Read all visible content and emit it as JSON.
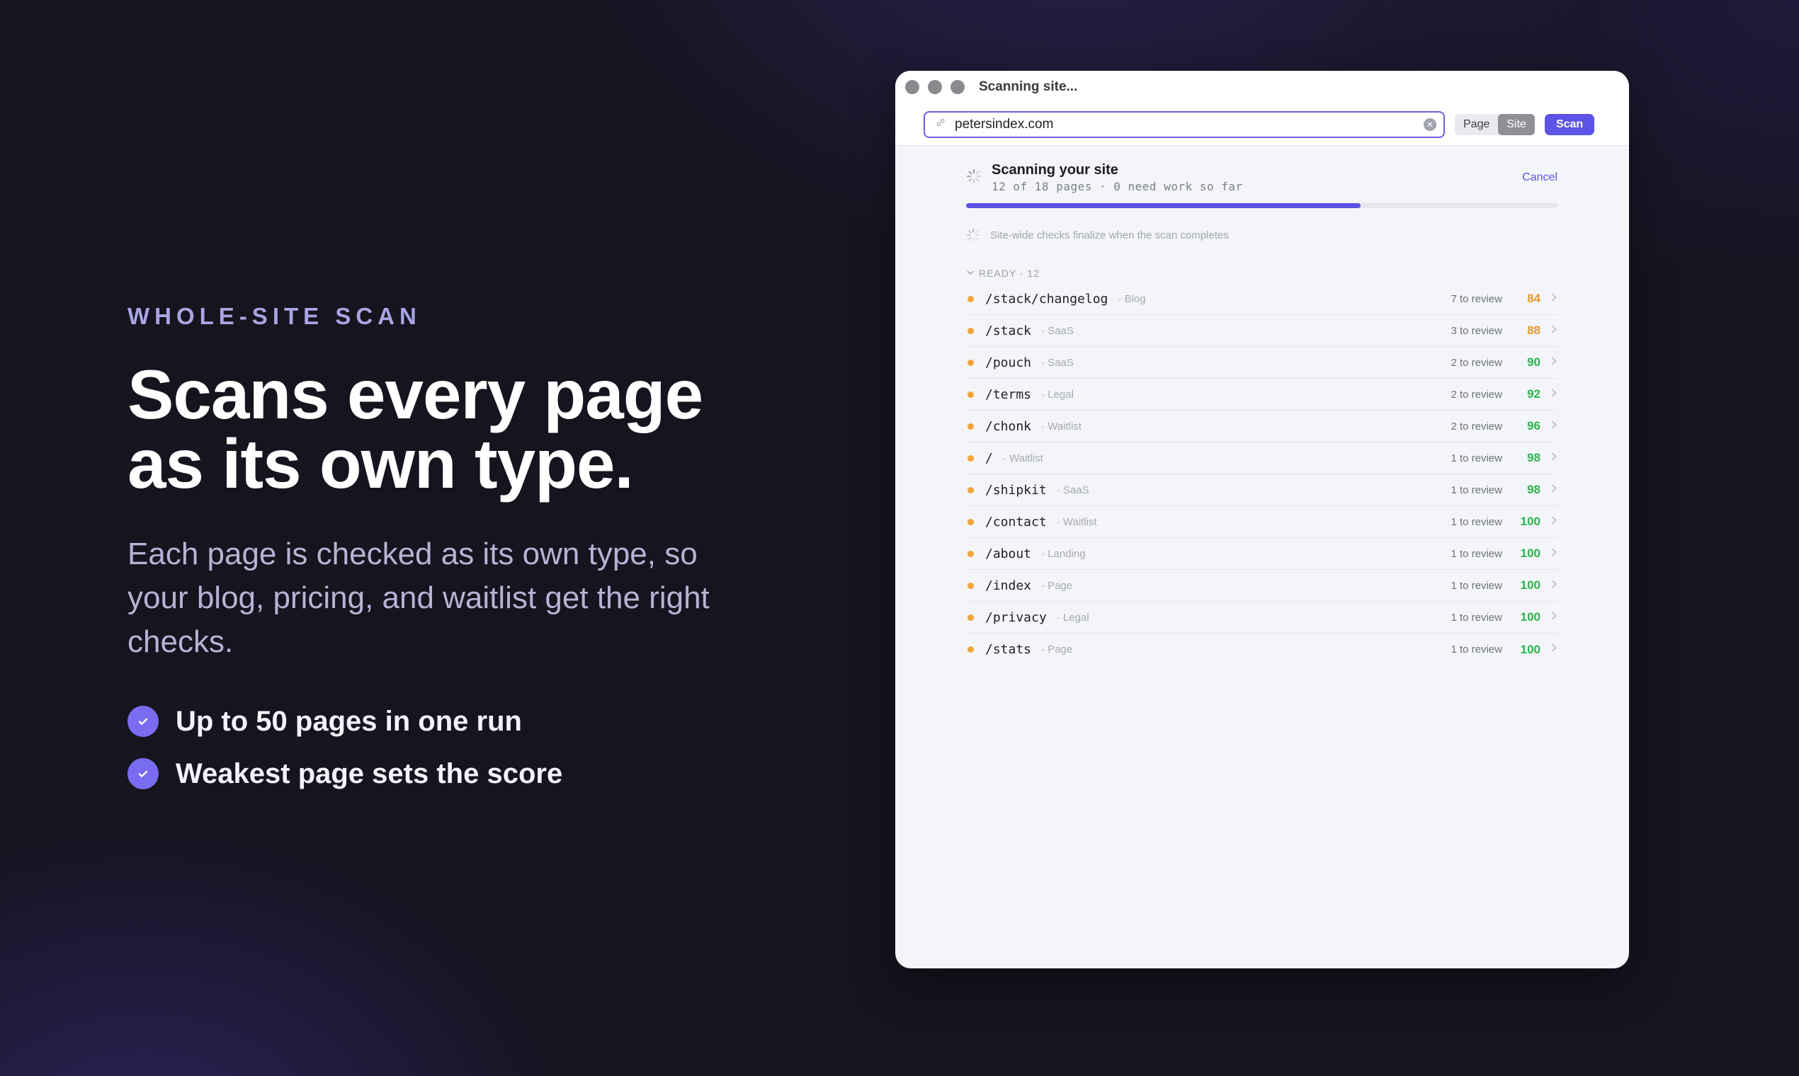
{
  "hero": {
    "eyebrow": "WHOLE-SITE SCAN",
    "headline_line1": "Scans every page",
    "headline_line2": "as its own type.",
    "subhead": "Each page is checked as its own type, so your blog, pricing, and waitlist get the right checks.",
    "bullets": [
      "Up to 50 pages in one run",
      "Weakest page sets the score"
    ]
  },
  "window": {
    "title": "Scanning site...",
    "url_value": "petersindex.com",
    "mode_page": "Page",
    "mode_site": "Site",
    "scan_label": "Scan"
  },
  "status": {
    "title": "Scanning your site",
    "subtitle": "12 of 18 pages · 0 need work so far",
    "cancel_label": "Cancel",
    "progress_fraction": 0.667,
    "note": "Site-wide checks finalize when the scan completes"
  },
  "group": {
    "header": "READY · 12"
  },
  "rows": [
    {
      "path": "/stack/changelog",
      "type": "Blog",
      "review": "7 to review",
      "score": "84",
      "tone": "amber"
    },
    {
      "path": "/stack",
      "type": "SaaS",
      "review": "3 to review",
      "score": "88",
      "tone": "amber"
    },
    {
      "path": "/pouch",
      "type": "SaaS",
      "review": "2 to review",
      "score": "90",
      "tone": "green"
    },
    {
      "path": "/terms",
      "type": "Legal",
      "review": "2 to review",
      "score": "92",
      "tone": "green"
    },
    {
      "path": "/chonk",
      "type": "Waitlist",
      "review": "2 to review",
      "score": "96",
      "tone": "green"
    },
    {
      "path": "/",
      "type": "Waitlist",
      "review": "1 to review",
      "score": "98",
      "tone": "green"
    },
    {
      "path": "/shipkit",
      "type": "SaaS",
      "review": "1 to review",
      "score": "98",
      "tone": "green"
    },
    {
      "path": "/contact",
      "type": "Waitlist",
      "review": "1 to review",
      "score": "100",
      "tone": "green"
    },
    {
      "path": "/about",
      "type": "Landing",
      "review": "1 to review",
      "score": "100",
      "tone": "green"
    },
    {
      "path": "/index",
      "type": "Page",
      "review": "1 to review",
      "score": "100",
      "tone": "green"
    },
    {
      "path": "/privacy",
      "type": "Legal",
      "review": "1 to review",
      "score": "100",
      "tone": "green"
    },
    {
      "path": "/stats",
      "type": "Page",
      "review": "1 to review",
      "score": "100",
      "tone": "green"
    }
  ],
  "icons": {
    "check": "check-icon",
    "link": "link-icon",
    "clear": "clear-icon",
    "spinner": "spinner-icon",
    "chevron_down": "chevron-down-icon",
    "chevron_right": "chevron-right-icon"
  },
  "colors": {
    "accent": "#5b54e6",
    "check_bg": "#7a6cf0",
    "pending_dot": "#f2a43a",
    "score_amber": "#e9962a",
    "score_green": "#2cb34c"
  }
}
